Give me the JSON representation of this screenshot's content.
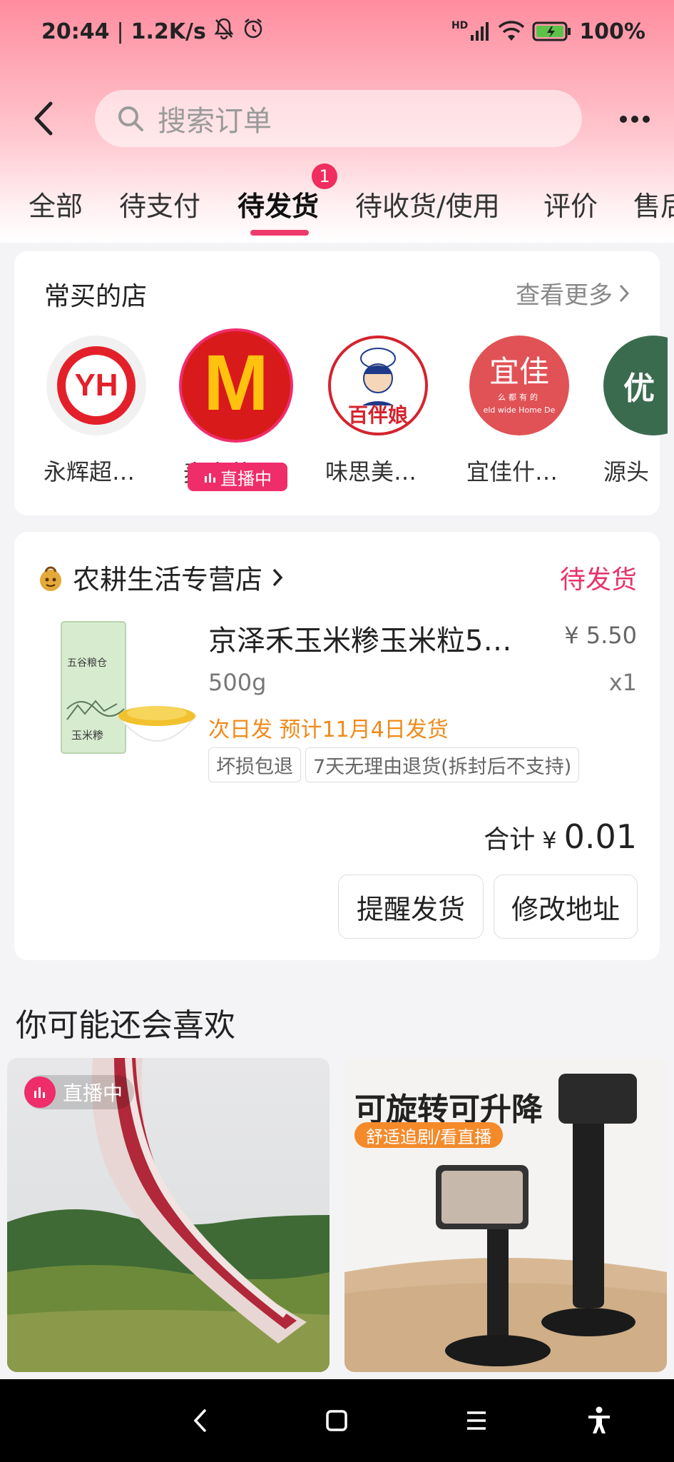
{
  "status_bar": {
    "time": "20:44",
    "speed": "1.2K/s",
    "network": "HD",
    "battery": "100%"
  },
  "search": {
    "placeholder": "搜索订单"
  },
  "tabs": [
    {
      "label": "全部"
    },
    {
      "label": "待支付"
    },
    {
      "label": "待发货",
      "badge": "1",
      "active": true
    },
    {
      "label": "待收货/使用"
    },
    {
      "label": "评价"
    },
    {
      "label": "售后"
    }
  ],
  "frequent_stores": {
    "title": "常买的店",
    "see_more": "查看更多",
    "live_label": "直播中",
    "stores": [
      {
        "name": "永辉超…",
        "logo_text": "YH",
        "live": false
      },
      {
        "name": "麦当劳…",
        "logo_text": "M",
        "live": true
      },
      {
        "name": "味思美…",
        "logo_text": "百伴娘",
        "live": false
      },
      {
        "name": "宜佳什…",
        "logo_text": "宜佳",
        "logo_sub": "么都有的",
        "logo_sub2": "eld wide Home De",
        "live": false
      },
      {
        "name": "源头",
        "logo_text": "优",
        "live": false
      }
    ]
  },
  "order": {
    "shop_name": "农耕生活专营店",
    "status": "待发货",
    "product_title": "京泽禾玉米糁玉米粒5…",
    "price": "¥ 5.50",
    "spec": "500g",
    "quantity": "x1",
    "ship_info": "次日发 预计11月4日发货",
    "tags": [
      "坏损包退",
      "7天无理由退货(拆封后不支持)"
    ],
    "total_label": "合计",
    "total_currency": "¥",
    "total_amount": "0.01",
    "product_image_text": {
      "brand": "五谷粮仓",
      "name": "玉米糁"
    },
    "buttons": {
      "remind": "提醒发货",
      "change_address": "修改地址"
    }
  },
  "recommendations": {
    "title": "你可能还会喜欢",
    "items": [
      {
        "live_label": "直播中"
      },
      {
        "headline": "可旋转可升降",
        "sub": "舒适追剧/看直播"
      }
    ]
  },
  "colors": {
    "accent": "#ef3b6b",
    "status_pink": "#e8336a",
    "ship_orange": "#f08a1a"
  }
}
